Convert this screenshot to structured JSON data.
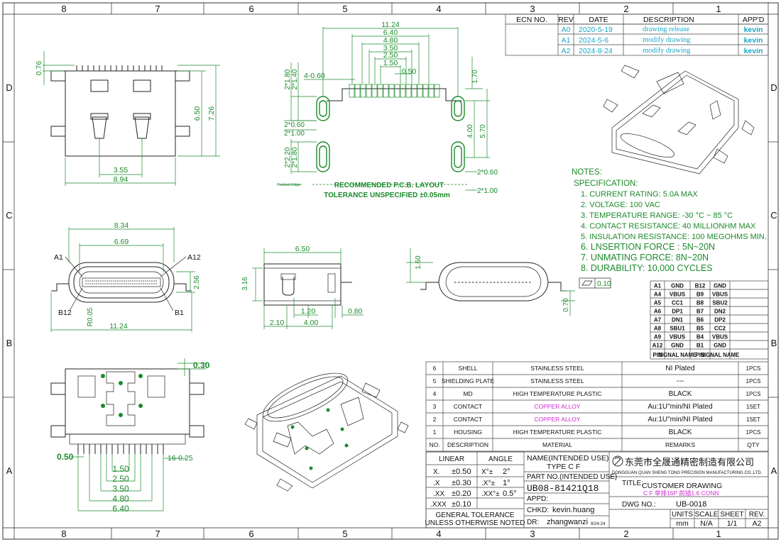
{
  "grid": {
    "columns": [
      "8",
      "7",
      "6",
      "5",
      "4",
      "3",
      "2",
      "1"
    ],
    "rows": [
      "D",
      "C",
      "B",
      "A"
    ]
  },
  "revision_table": {
    "headers": [
      "ECN NO.",
      "REV",
      "DATE",
      "DESCRIPTION",
      "APP'D"
    ],
    "rows": [
      {
        "rev": "A0",
        "date": "2020-5-19",
        "desc": "drawing release",
        "app": "kevin"
      },
      {
        "rev": "A1",
        "date": "2024-5-6",
        "desc": "modify drawing",
        "app": "kevin"
      },
      {
        "rev": "A2",
        "date": "2024-8-24",
        "desc": "modify drawing",
        "app": "kevin"
      }
    ]
  },
  "top_view": {
    "dims": [
      "0.76",
      "6.50",
      "7.26",
      "3.55",
      "8.94"
    ]
  },
  "pcb_layout": {
    "dims": [
      "11.24",
      "6.40",
      "4.80",
      "3.50",
      "2.50",
      "1.50",
      "0.50",
      "4-0.60",
      "2*1.80",
      "2*1.40",
      "1.70",
      "2*0.60",
      "2*1.00",
      "2*2.20",
      "2*1.80",
      "4.00",
      "5.70",
      "2*0.60",
      "2*1.00"
    ],
    "edge_label": "Product Edge",
    "title": "RECOMMENDED  P.C.B. LAYOUT",
    "tolerance": "TOLERANCE UNSPECIFIED ±0.05mm"
  },
  "notes": {
    "title": "NOTES:",
    "spec": "SPECIFICATION:",
    "items": [
      "1. CURRENT RATING: 5.0A MAX",
      "2. VOLTAGE: 100 VAC",
      "3. TEMPERATURE RANGE: -30 °C ~ 85 °C",
      "4. CONTACT RESISTANCE: 40 MILLIONHM MAX",
      "5. INSULATION RESISTANCE: 100 MEGOHMS MIN.",
      "6. LNSERTION FORCE : 5N~20N",
      "7. UNMATING FORCE: 8N~20N",
      "8. DURABILITY:   10,000 CYCLES"
    ]
  },
  "front_view": {
    "dims": [
      "8.34",
      "6.69",
      "2.56",
      "R0.05",
      "11.24"
    ],
    "labels": [
      "A1",
      "A12",
      "B12",
      "B1"
    ]
  },
  "side_view": {
    "dims": [
      "6.50",
      "3.16",
      "1.20",
      "0.80",
      "2.10",
      "4.00"
    ]
  },
  "rear_view": {
    "dims": [
      "1.60",
      "0.70"
    ],
    "flatness": "0.10"
  },
  "pin_table": {
    "headers": [
      "PIN",
      "SIGNAL NAME",
      "PIN",
      "SIGNAL NAME"
    ],
    "rows": [
      [
        "A1",
        "GND",
        "B12",
        "GND"
      ],
      [
        "A4",
        "VBUS",
        "B9",
        "VBUS"
      ],
      [
        "A5",
        "CC1",
        "B8",
        "SBU2"
      ],
      [
        "A6",
        "DP1",
        "B7",
        "DN2"
      ],
      [
        "A7",
        "DN1",
        "B6",
        "DP2"
      ],
      [
        "A8",
        "SBU1",
        "B5",
        "CC2"
      ],
      [
        "A9",
        "VBUS",
        "B4",
        "VBUS"
      ],
      [
        "A12",
        "GND",
        "B1",
        "GND"
      ]
    ]
  },
  "bottom_view": {
    "dims": [
      "0.30",
      "0.50",
      "16-0.25",
      "1.50",
      "2.50",
      "3.50",
      "4.80",
      "6.40"
    ]
  },
  "bom": {
    "rows": [
      {
        "no": "6",
        "desc": "SHELL",
        "material": "STAINLESS STEEL",
        "remarks": "NI Plated",
        "qty": "1PCS"
      },
      {
        "no": "5",
        "desc": "SHIELDING PLATE",
        "material": "STAINLESS STEEL",
        "remarks": "---",
        "qty": "1PCS"
      },
      {
        "no": "4",
        "desc": "MD",
        "material": "HIGH TEMPERATURE PLASTIC",
        "remarks": "BLACK",
        "qty": "1PCS"
      },
      {
        "no": "3",
        "desc": "CONTACT",
        "material": "COPPER ALLOY",
        "remarks": "Au:1U\"min/NI Plated",
        "qty": "1SET"
      },
      {
        "no": "2",
        "desc": "CONTACT",
        "material": "COPPER ALLOY",
        "remarks": "Au:1U\"min/NI Plated",
        "qty": "1SET"
      },
      {
        "no": "1",
        "desc": "HOUSING",
        "material": "HIGH TEMPERATURE PLASTIC",
        "remarks": "BLACK",
        "qty": "1PCS"
      }
    ],
    "headers": [
      "NO.",
      "DESCRIPTION",
      "MATERIAL",
      "REMARKS",
      "QTY"
    ]
  },
  "title_block": {
    "linear": "LINEAR",
    "angle": "ANGLE",
    "tol_rows": [
      {
        "lin_a": "X.",
        "lin_b": "±0.50",
        "ang_a": "X°±",
        "ang_b": "2°"
      },
      {
        "lin_a": ".X",
        "lin_b": "±0.30",
        "ang_a": ".X°±",
        "ang_b": "1°"
      },
      {
        "lin_a": ".XX",
        "lin_b": "±0.20",
        "ang_a": ".XX°±",
        "ang_b": "0.5°"
      },
      {
        "lin_a": ".XXX",
        "lin_b": "±0.10",
        "ang_a": "",
        "ang_b": ""
      }
    ],
    "general1": "GENERAL TOLERANCE",
    "general2": "UNLESS OTHERWISE NOTED",
    "name_label": "NAME(INTENDED USE)",
    "name_value": "TYPE C F",
    "part_label": "PART NO.(INTENDED USE)",
    "part_no": "UB08-81421Q18",
    "appd": "APPD:",
    "chkd_label": "CHKD:",
    "chkd": "kevin.huang",
    "dr_label": "DR:",
    "dr": "zhangwanzi",
    "dr_date": "8/24-24",
    "company_cn": "东莞市全晟通精密制造有限公司",
    "company_en": "DONGGUAN QUAN SHENG TONG PRECISION  MANUFACTURING CO.,LTD.",
    "title_label": "TITLE:",
    "title": "CUSTOMER DRAWING",
    "subtitle": "C F 单排16P 前插1.6 CONN",
    "dwg_label": "DWG NO.:",
    "dwg_no": "UB-0018",
    "units_label": "UNITS",
    "scale_label": "SCALE",
    "sheet_label": "SHEET",
    "rev_label": "REV.",
    "units": "mm",
    "scale": "N/A",
    "sheet": "1/1",
    "rev": "A2"
  }
}
